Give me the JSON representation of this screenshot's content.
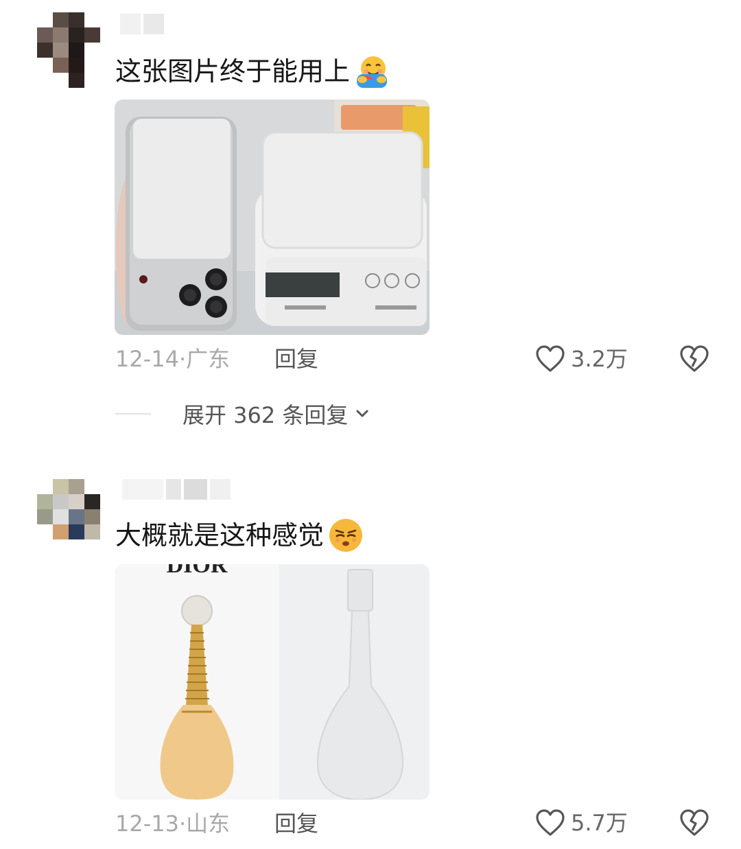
{
  "comments": [
    {
      "text": "这张图片终于能用上",
      "emoji": "hug-emoji",
      "date": "12-14",
      "location": "广东",
      "reply_label": "回复",
      "likes": "3.2万",
      "image": "phone-vs-kitchen-scale-photo"
    },
    {
      "text": "大概就是这种感觉",
      "emoji": "smug-face-emoji",
      "date": "12-13",
      "location": "山东",
      "reply_label": "回复",
      "likes": "5.7万",
      "image": "dior-perfume-vs-plastic-bottle-photo",
      "image_text": "DIOR"
    }
  ],
  "expand_replies": "展开 362 条回复",
  "separator": "·",
  "colors": {
    "meta": "#a8a8a8",
    "text": "#161616",
    "icon": "#555555"
  }
}
